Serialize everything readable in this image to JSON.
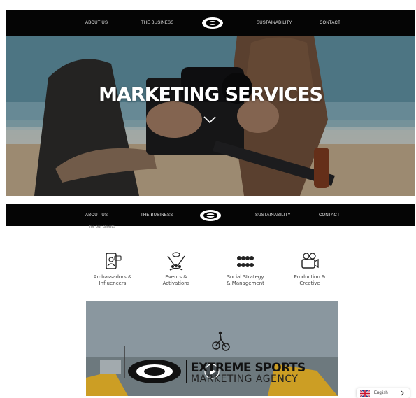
{
  "nav": {
    "items": [
      "ABOUT US",
      "THE BUSINESS",
      "SUSTAINABILITY",
      "CONTACT"
    ]
  },
  "hero": {
    "title": "MARKETING SERVICES"
  },
  "section": {
    "cut_text": "for our clients"
  },
  "services": [
    {
      "label_line1": "Ambassadors &",
      "label_line2": "Influencers",
      "icon": "ambassador-icon"
    },
    {
      "label_line1": "Events &",
      "label_line2": "Activations",
      "icon": "events-icon"
    },
    {
      "label_line1": "Social Strategy",
      "label_line2": "& Management",
      "icon": "social-icon"
    },
    {
      "label_line1": "Production &",
      "label_line2": "Creative",
      "icon": "camera-icon"
    }
  ],
  "video": {
    "brand_line1": "EXTREME SPORTS",
    "brand_line2": "MARKETING AGENCY"
  },
  "language": {
    "label": "English"
  },
  "colors": {
    "nav_bg": "#050505",
    "nav_text": "#e8e8e8",
    "accent_yellow": "#f2c230"
  }
}
